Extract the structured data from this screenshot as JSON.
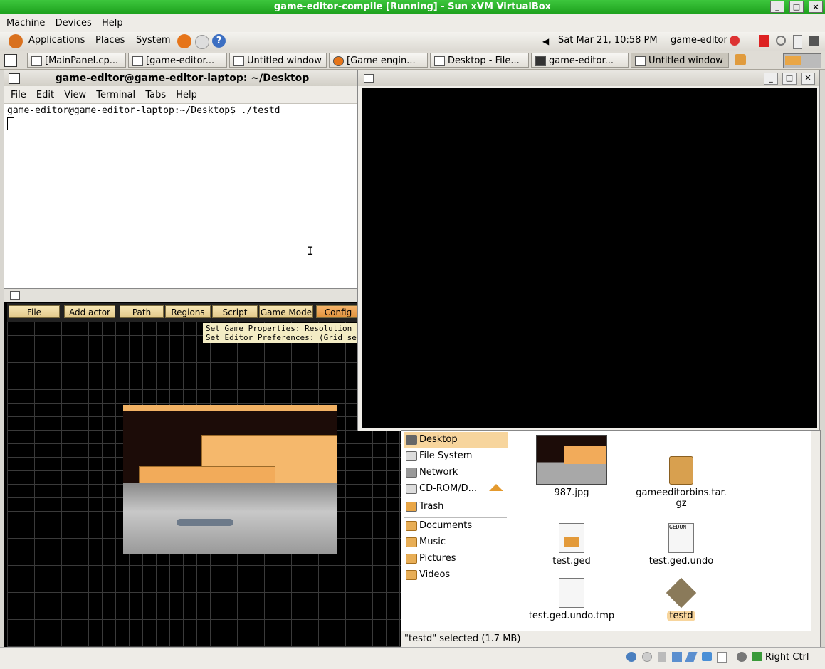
{
  "vbox": {
    "title": "game-editor-compile [Running] - Sun xVM VirtualBox",
    "menu": [
      "Machine",
      "Devices",
      "Help"
    ],
    "host_key": "Right Ctrl"
  },
  "top_panel": {
    "menus": [
      "Applications",
      "Places",
      "System"
    ],
    "clock": "Sat Mar 21, 10:58 PM",
    "user": "game-editor"
  },
  "taskbar": {
    "tasks": [
      "[MainPanel.cp...",
      "[game-editor...",
      "Untitled window",
      "[Game engin...",
      "Desktop - File...",
      "game-editor...",
      "Untitled window"
    ]
  },
  "terminal": {
    "title": "game-editor@game-editor-laptop: ~/Desktop",
    "menu": [
      "File",
      "Edit",
      "View",
      "Terminal",
      "Tabs",
      "Help"
    ],
    "prompt_line": "game-editor@game-editor-laptop:~/Desktop$ ./testd"
  },
  "game_editor": {
    "toolbar": [
      "File",
      "Add actor",
      "Path",
      "Regions",
      "Script",
      "Game Mode",
      "Config"
    ],
    "tooltip_line1": "Set Game Properties: Resolution",
    "tooltip_line2": "Set Editor Preferences: (Grid sett"
  },
  "file_browser": {
    "places": [
      "Desktop",
      "File System",
      "Network",
      "CD-ROM/D...",
      "Trash"
    ],
    "bookmarks": [
      "Documents",
      "Music",
      "Pictures",
      "Videos"
    ],
    "files": [
      {
        "name": "987.jpg"
      },
      {
        "name": "gameeditorbins.tar.\ngz"
      },
      {
        "name": "test.ged"
      },
      {
        "name": "test.ged.undo",
        "badge": "GEDUN"
      },
      {
        "name": "test.ged.undo.tmp"
      },
      {
        "name": "testd"
      }
    ],
    "status": "\"testd\" selected (1.7 MB)"
  },
  "colors": {
    "vbox_title": "#1ea21e",
    "selection": "#f7d59d",
    "editor_button": "#e2c88a"
  }
}
